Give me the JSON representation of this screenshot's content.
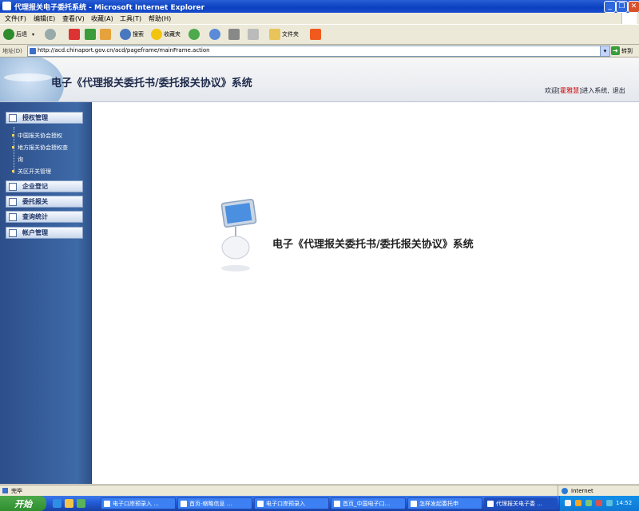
{
  "window": {
    "title": "代理报关电子委托系统 - Microsoft Internet Explorer"
  },
  "menu": [
    "文件(F)",
    "编辑(E)",
    "查看(V)",
    "收藏(A)",
    "工具(T)",
    "帮助(H)"
  ],
  "toolbar": {
    "back": "后退",
    "search": "搜索",
    "favorites": "收藏夹",
    "folders": "文件夹"
  },
  "address": {
    "label": "地址(D)",
    "url": "http://acd.chinaport.gov.cn/acd/pageframe/mainFrame.action",
    "go": "转到"
  },
  "header": {
    "system_title": "电子《代理报关委托书/委托报关协议》系统",
    "welcome_prefix": "欢迎[",
    "user": "霍雅慧",
    "welcome_suffix": "]进入系统,",
    "logout": "退出"
  },
  "sidebar": {
    "sections": [
      {
        "label": "授权管理",
        "items": [
          "中国报关协会授权",
          "地方报关协会授权查",
          "询",
          "关区开关管理"
        ]
      },
      {
        "label": "企业登记"
      },
      {
        "label": "委托报关"
      },
      {
        "label": "查询统计"
      },
      {
        "label": "帐户管理"
      }
    ]
  },
  "content": {
    "title": "电子《代理报关委托书/委托报关协议》系统"
  },
  "status": {
    "text": "完毕",
    "zone": "Internet"
  },
  "taskbar": {
    "start": "开始",
    "tasks": [
      "电子口岸预录入 ...",
      "首页-缩略信息 ...",
      "电子口岸预录入",
      "首页_中国电子口...",
      "怎样发起委托申",
      "代理报关电子委 ..."
    ],
    "clock": "14:52"
  }
}
